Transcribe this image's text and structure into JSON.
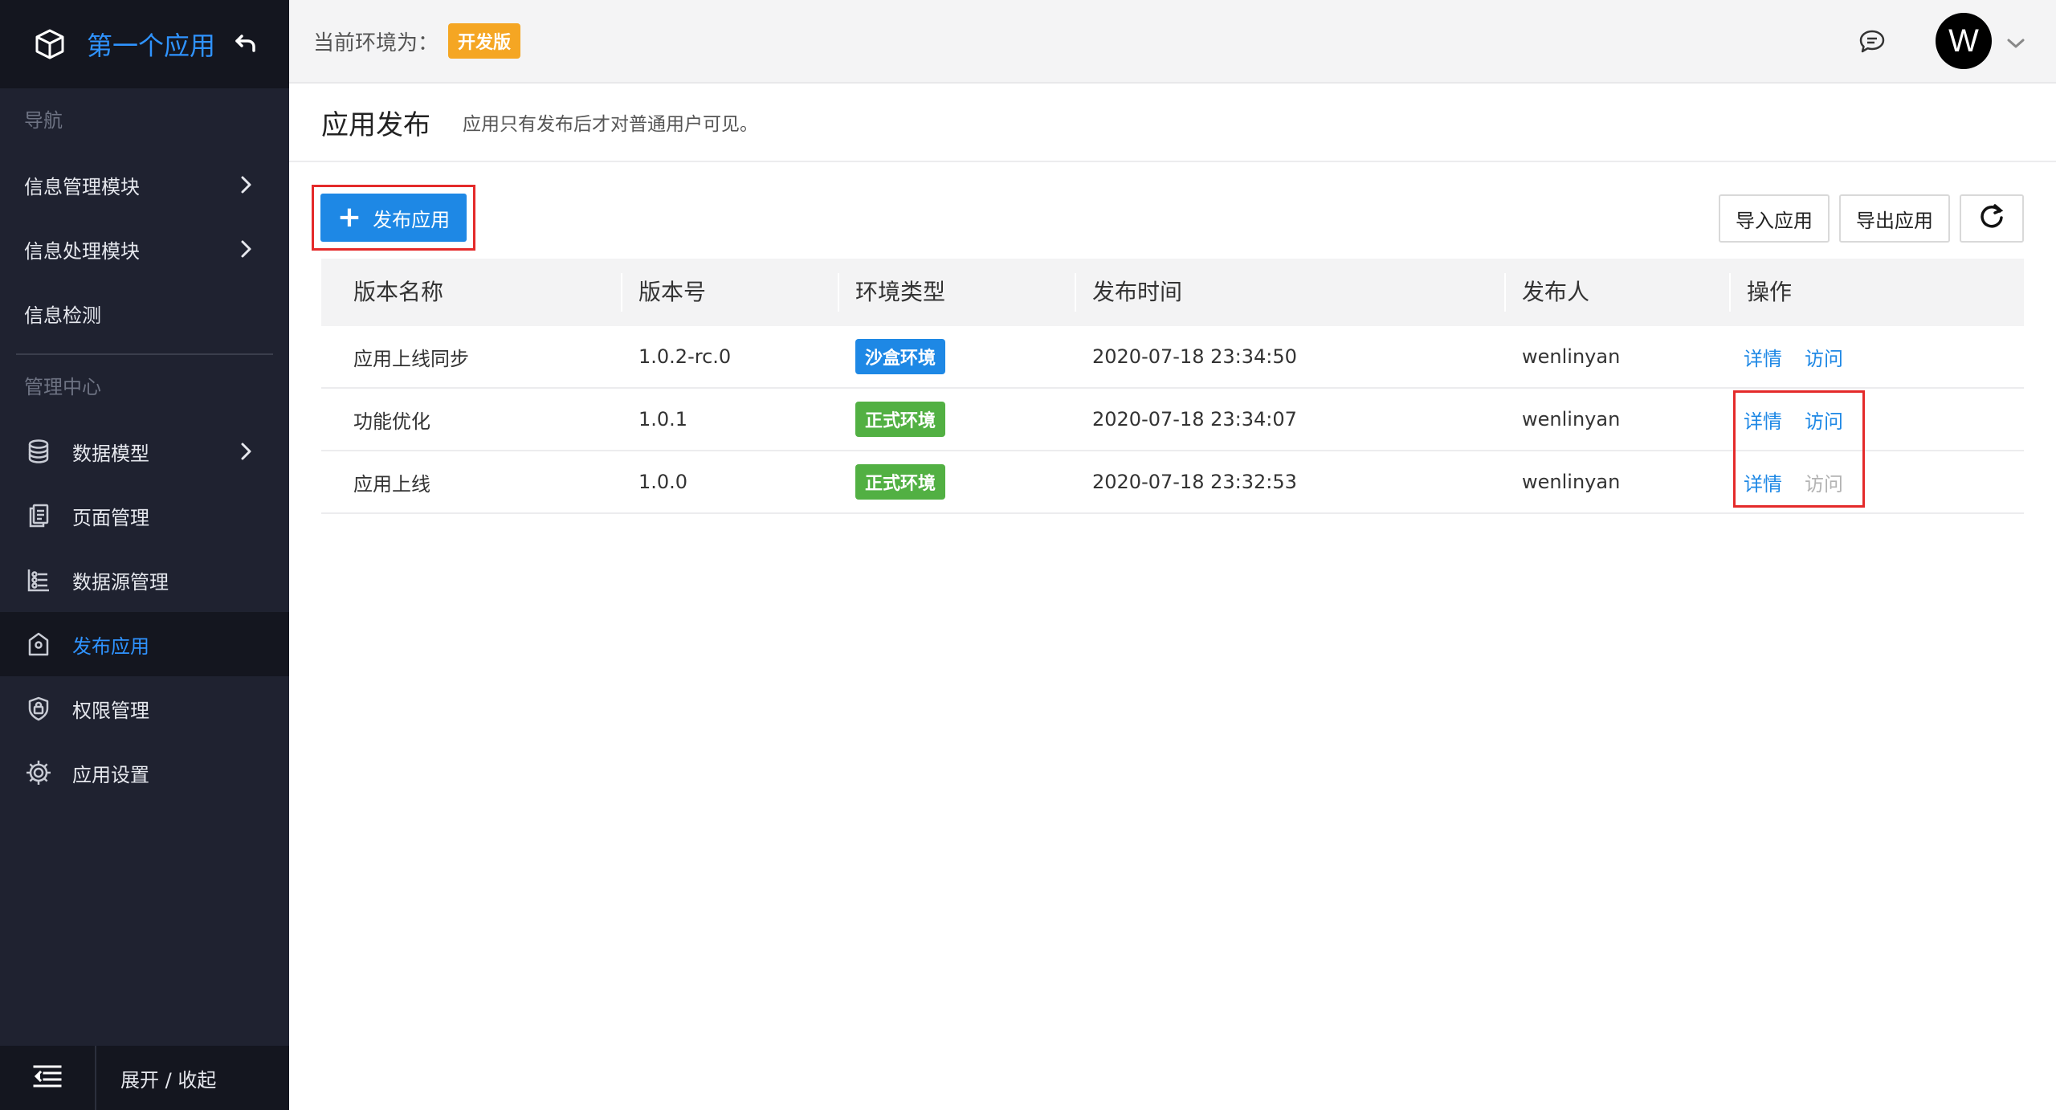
{
  "sidebar": {
    "app_title": "第一个应用",
    "section_nav": "导航",
    "nav_items": [
      {
        "label": "信息管理模块"
      },
      {
        "label": "信息处理模块"
      },
      {
        "label": "信息检测"
      }
    ],
    "section_admin": "管理中心",
    "admin_items": [
      {
        "label": "数据模型",
        "icon": "database-icon"
      },
      {
        "label": "页面管理",
        "icon": "pages-icon"
      },
      {
        "label": "数据源管理",
        "icon": "datasource-icon"
      },
      {
        "label": "发布应用",
        "icon": "publish-icon",
        "active": true
      },
      {
        "label": "权限管理",
        "icon": "shield-lock-icon"
      },
      {
        "label": "应用设置",
        "icon": "gear-icon"
      }
    ],
    "footer_label": "展开 / 收起"
  },
  "header": {
    "env_label": "当前环境为：",
    "env_badge": "开发版",
    "avatar_letter": "W"
  },
  "page": {
    "title": "应用发布",
    "subtitle": "应用只有发布后才对普通用户可见。"
  },
  "toolbar": {
    "publish_label": "发布应用",
    "import_label": "导入应用",
    "export_label": "导出应用"
  },
  "table": {
    "headers": {
      "name": "版本名称",
      "version": "版本号",
      "env": "环境类型",
      "time": "发布时间",
      "user": "发布人",
      "ops": "操作"
    },
    "rows": [
      {
        "name": "应用上线同步",
        "version": "1.0.2-rc.0",
        "env": "沙盒环境",
        "env_color": "#1e88e5",
        "time": "2020-07-18 23:34:50",
        "user": "wenlinyan",
        "detail": "详情",
        "visit": "访问",
        "visit_enabled": true
      },
      {
        "name": "功能优化",
        "version": "1.0.1",
        "env": "正式环境",
        "env_color": "#52b043",
        "time": "2020-07-18 23:34:07",
        "user": "wenlinyan",
        "detail": "详情",
        "visit": "访问",
        "visit_enabled": true
      },
      {
        "name": "应用上线",
        "version": "1.0.0",
        "env": "正式环境",
        "env_color": "#52b043",
        "time": "2020-07-18 23:32:53",
        "user": "wenlinyan",
        "detail": "详情",
        "visit": "访问",
        "visit_enabled": false
      }
    ]
  },
  "colors": {
    "sidebar_bg": "#1f2230",
    "accent": "#1e88e5",
    "dev_badge": "#f5a623",
    "highlight_box": "#e42a2a"
  }
}
